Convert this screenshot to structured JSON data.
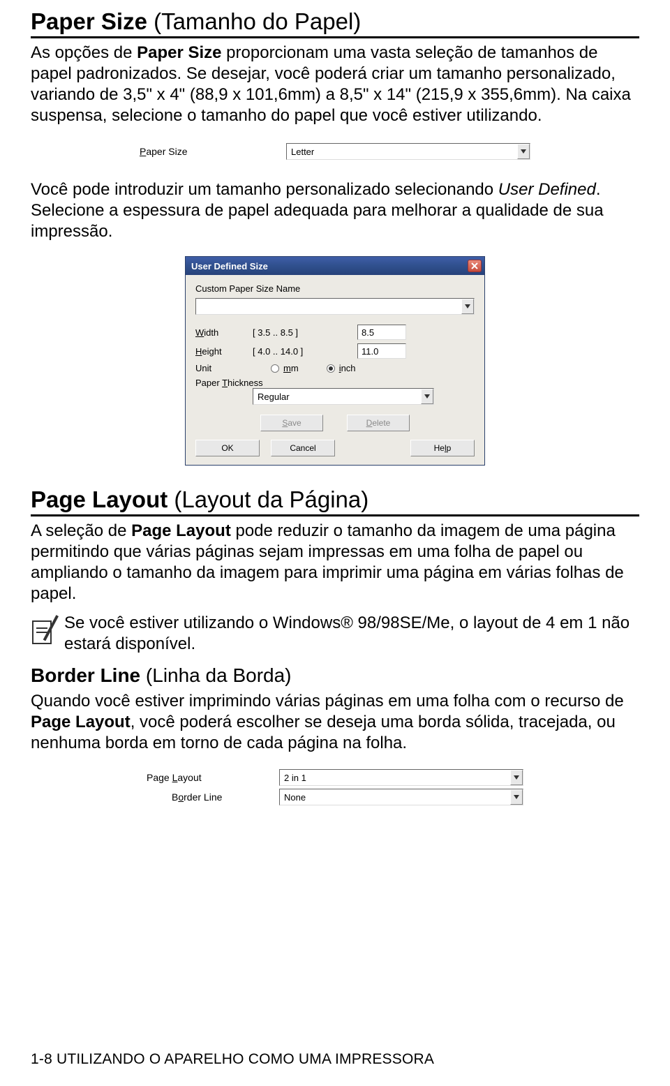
{
  "section1": {
    "heading_bold": "Paper Size",
    "heading_rest": " (Tamanho do Papel)",
    "para1_pre": "As opções de ",
    "para1_b1": "Paper Size",
    "para1_post": " proporcionam uma vasta seleção de tamanhos de papel padronizados. Se desejar, você poderá criar um tamanho personalizado, variando de 3,5\" x 4\" (88,9 x 101,6mm) a 8,5\" x 14\" (215,9 x 355,6mm). Na caixa suspensa, selecione o tamanho do papel que você estiver utilizando.",
    "control": {
      "label_pre": "P",
      "label_post": "aper Size",
      "value": "Letter"
    },
    "para2_pre": "Você pode introduzir um tamanho personalizado selecionando ",
    "para2_em": "User Defined",
    "para2_post": ". Selecione a espessura de papel adequada para melhorar a qualidade de sua impressão."
  },
  "dialog": {
    "title": "User Defined Size",
    "group_label": "Custom Paper Size Name",
    "name_value": "",
    "width": {
      "label_u": "W",
      "label_rest": "idth",
      "range": "[ 3.5    ..   8.5   ]",
      "value": "8.5"
    },
    "height": {
      "label_u": "H",
      "label_rest": "eight",
      "range": "[ 4.0    ..  14.0  ]",
      "value": "11.0"
    },
    "unit": {
      "label": "Unit",
      "mm_u": "m",
      "mm_rest": "m",
      "inch_u": "i",
      "inch_rest": "nch"
    },
    "thickness": {
      "label_pre": "Paper ",
      "label_u": "T",
      "label_post": "hickness",
      "value": "Regular"
    },
    "buttons": {
      "save_u": "S",
      "save_rest": "ave",
      "delete_u": "D",
      "delete_rest": "elete",
      "ok": "OK",
      "cancel": "Cancel",
      "help_pre": "He",
      "help_u": "l",
      "help_post": "p"
    }
  },
  "section2": {
    "heading_bold": "Page Layout",
    "heading_rest": " (Layout da Página)",
    "para_pre": "A seleção de ",
    "para_b": "Page Layout",
    "para_post": " pode reduzir o tamanho da imagem de uma página permitindo que várias páginas sejam impressas em uma folha de papel ou ampliando o tamanho da imagem para imprimir uma página em várias folhas de papel.",
    "note": "Se você estiver utilizando o Windows® 98/98SE/Me, o layout de 4 em 1 não estará disponível."
  },
  "section3": {
    "heading_bold": "Border Line",
    "heading_rest": " (Linha da Borda)",
    "para_pre": "Quando você estiver imprimindo várias páginas em uma folha com o recurso de ",
    "para_b": "Page Layout",
    "para_post": ", você poderá escolher se deseja uma borda sólida, tracejada, ou nenhuma borda em torno de cada página na folha.",
    "controls": {
      "page_layout": {
        "label_pre": "Page ",
        "label_u": "L",
        "label_post": "ayout",
        "value": "2 in 1"
      },
      "border_line": {
        "label_pre": "B",
        "label_u": "o",
        "label_post": "rder Line",
        "value": "None"
      }
    }
  },
  "footer": "1-8 UTILIZANDO O APARELHO COMO UMA IMPRESSORA"
}
